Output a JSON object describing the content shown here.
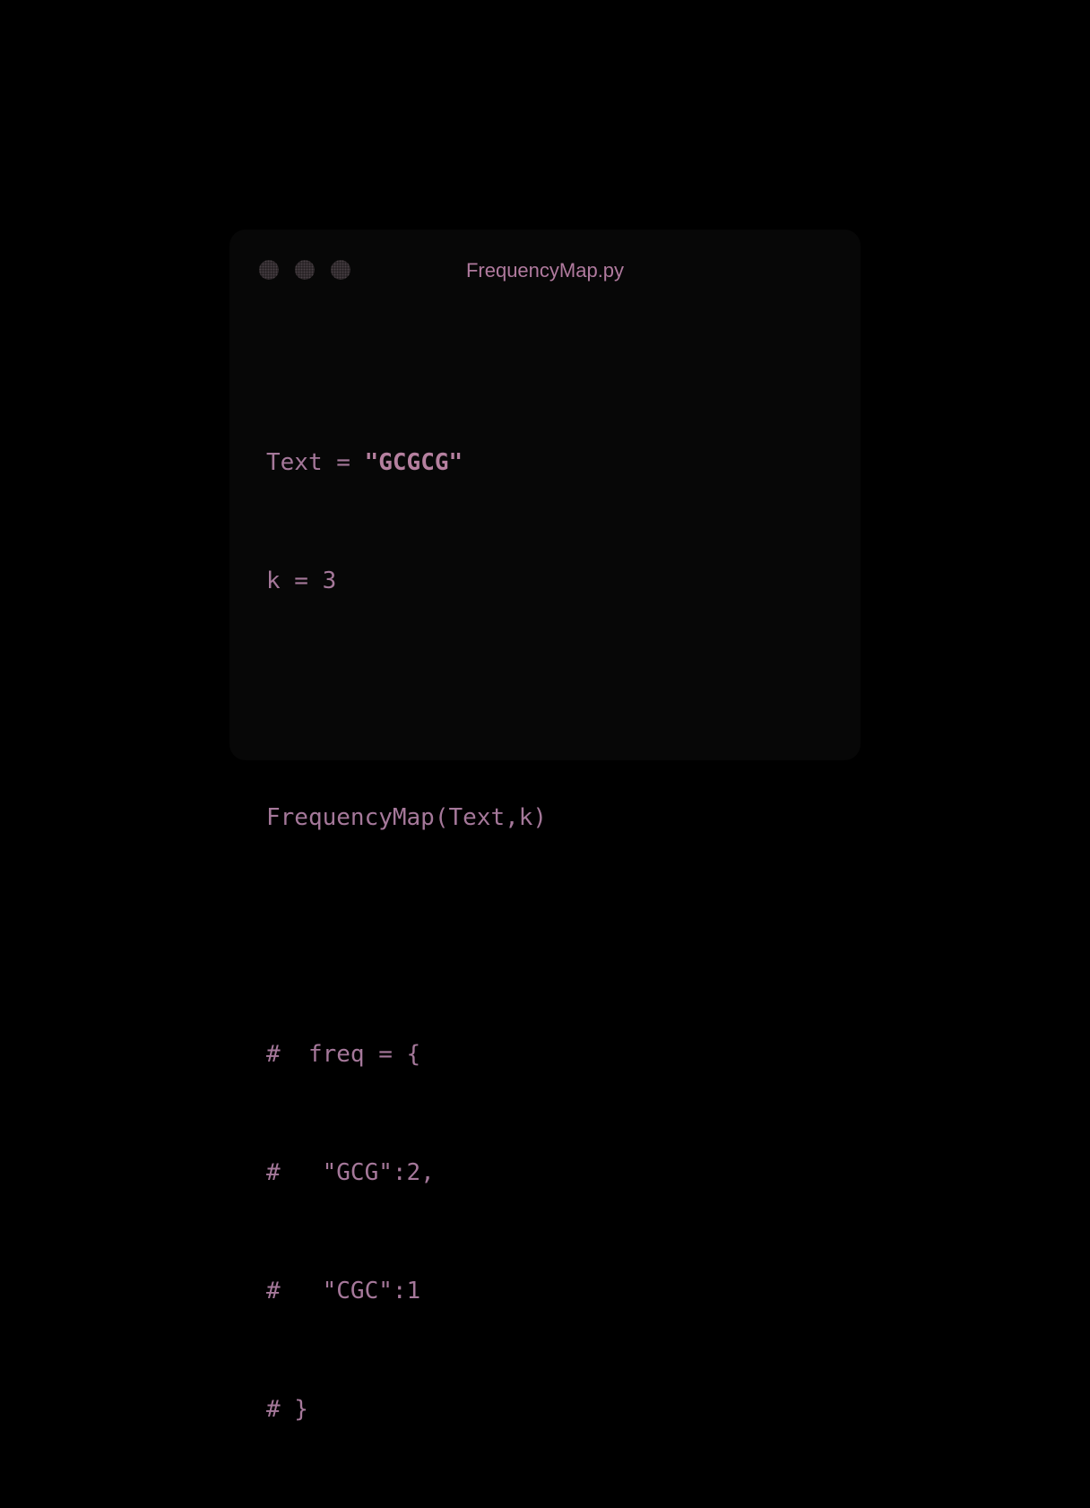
{
  "window": {
    "title": "FrequencyMap.py"
  },
  "code": {
    "line1_a": "Text = ",
    "line1_b": "\"GCGCG\"",
    "line2": "k = 3",
    "line3": "",
    "line4": "FrequencyMap(Text,k)",
    "line5": "",
    "line6": "#  freq = {",
    "line7": "#   \"GCG\":2,",
    "line8": "#   \"CGC\":1",
    "line9": "# }"
  },
  "colors": {
    "background": "#000000",
    "window": "#070707",
    "text": "#a5789a",
    "title": "#b07a9e"
  }
}
